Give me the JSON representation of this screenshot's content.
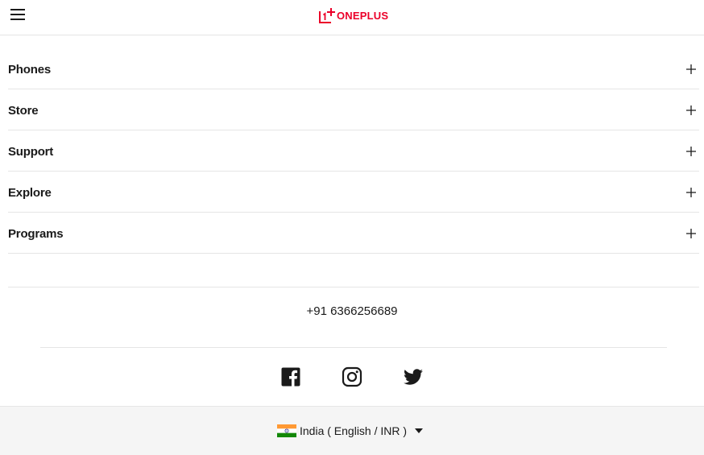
{
  "header": {
    "menu_icon": "hamburger-menu-icon",
    "logo_text": "ONEPLUS",
    "brand_color": "#eb0029"
  },
  "nav": {
    "items": [
      {
        "label": "Phones",
        "icon": "plus-icon"
      },
      {
        "label": "Store",
        "icon": "plus-icon"
      },
      {
        "label": "Support",
        "icon": "plus-icon"
      },
      {
        "label": "Explore",
        "icon": "plus-icon"
      },
      {
        "label": "Programs",
        "icon": "plus-icon"
      }
    ]
  },
  "contact": {
    "phone": "+91 6366256689"
  },
  "social": {
    "items": [
      {
        "icon": "facebook-icon"
      },
      {
        "icon": "instagram-icon"
      },
      {
        "icon": "twitter-icon"
      }
    ]
  },
  "region": {
    "flag_icon": "india-flag-icon",
    "label": "India ( English / INR )",
    "dropdown_icon": "caret-down-icon"
  }
}
